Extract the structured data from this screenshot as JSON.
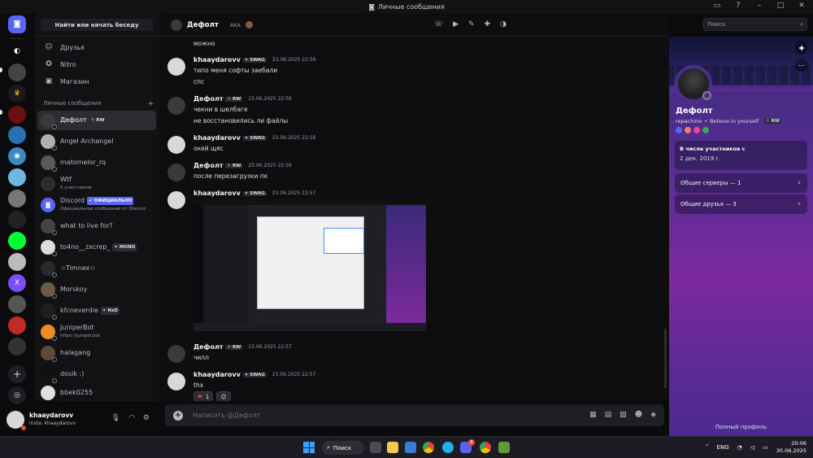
{
  "window": {
    "title": "Личные сообщения"
  },
  "dm_sidebar": {
    "search_label": "Найти или начать беседу",
    "nav": [
      {
        "label": "Друзья",
        "icon": "friends-icon"
      },
      {
        "label": "Nitro",
        "icon": "nitro-icon"
      },
      {
        "label": "Магазин",
        "icon": "shop-icon"
      }
    ],
    "section_header": "Личные сообщения",
    "add_symbol": "+",
    "items": [
      {
        "name": "Дефолт",
        "tag": "✌ RW",
        "sub": ""
      },
      {
        "name": "Angel Archangel",
        "tag": "",
        "sub": ""
      },
      {
        "name": "matomelor_rq",
        "tag": "",
        "sub": ""
      },
      {
        "name": "Wtf",
        "tag": "",
        "sub": "5 участников"
      },
      {
        "name": "Discord",
        "tag": "✔ ОФИЦИАЛЬНО",
        "sub": "Официальное сообщение от Discord"
      },
      {
        "name": "what to live for?",
        "tag": "",
        "sub": ""
      },
      {
        "name": "to4no__zxcrep_",
        "tag": "✦ MONO",
        "sub": ""
      },
      {
        "name": "☆Timnex☆",
        "tag": "",
        "sub": ""
      },
      {
        "name": "Morskoy",
        "tag": "",
        "sub": ""
      },
      {
        "name": "kfcneverdie",
        "tag": "✦ NxD",
        "sub": ""
      },
      {
        "name": "JuniperBot",
        "tag": "",
        "sub": "https://juniper.bot"
      },
      {
        "name": "halagang",
        "tag": "",
        "sub": ""
      },
      {
        "name": "dosik :)",
        "tag": "",
        "sub": ""
      },
      {
        "name": "bbek0255",
        "tag": "",
        "sub": ""
      }
    ]
  },
  "user_panel": {
    "name": "khaaydarovv",
    "status": "insta: khaaydarovv"
  },
  "chat_header": {
    "name": "Дефолт",
    "aka_label": "AKA",
    "search_placeholder": "Поиск"
  },
  "messages": {
    "top_line": "можно",
    "groups": [
      {
        "author": "khaaydarovv",
        "tag": "✦ SWAG",
        "time": "23.06.2025 22:56",
        "lines": [
          "типо меня софты заебали",
          "спс"
        ]
      },
      {
        "author": "Дефолт",
        "tag": "✌ RW",
        "time": "23.06.2025 22:56",
        "lines": [
          "чекни в шелбаге",
          "не восстановились ли файлы"
        ]
      },
      {
        "author": "khaaydarovv",
        "tag": "✦ SWAG",
        "time": "23.06.2025 22:56",
        "lines": [
          "окей щяс"
        ]
      },
      {
        "author": "Дефолт",
        "tag": "✌ RW",
        "time": "23.06.2025 22:56",
        "lines": [
          "после перезагрузки пк"
        ]
      },
      {
        "author": "khaaydarovv",
        "tag": "✦ SWAG",
        "time": "23.06.2025 22:57",
        "lines": []
      },
      {
        "author": "Дефолт",
        "tag": "✌ RW",
        "time": "23.06.2025 22:57",
        "lines": [
          "чилл"
        ]
      },
      {
        "author": "khaaydarovv",
        "tag": "✦ SWAG",
        "time": "23.06.2025 22:57",
        "lines": [
          "thx"
        ]
      }
    ],
    "reaction": {
      "emoji": "❤",
      "count": "1"
    }
  },
  "composer": {
    "placeholder": "Написать @Дефолт"
  },
  "profile": {
    "name": "Дефолт",
    "username": "repachino",
    "bio": "Believe in yourself",
    "tag": "✌ RW",
    "member_since_label": "В числе участников с",
    "member_since": "2 дек. 2019 г.",
    "mutual_servers": "Общие серверы — 1",
    "mutual_friends": "Общие друзья — 3",
    "full_profile": "Полный профиль",
    "badge_colors": [
      "#5865f2",
      "#f47b67",
      "#eb459e",
      "#3ba55c"
    ]
  },
  "taskbar": {
    "search_label": "Поиск",
    "lang": "ENG",
    "time": "20:06",
    "date": "30.06.2025",
    "app_badge": "8"
  }
}
